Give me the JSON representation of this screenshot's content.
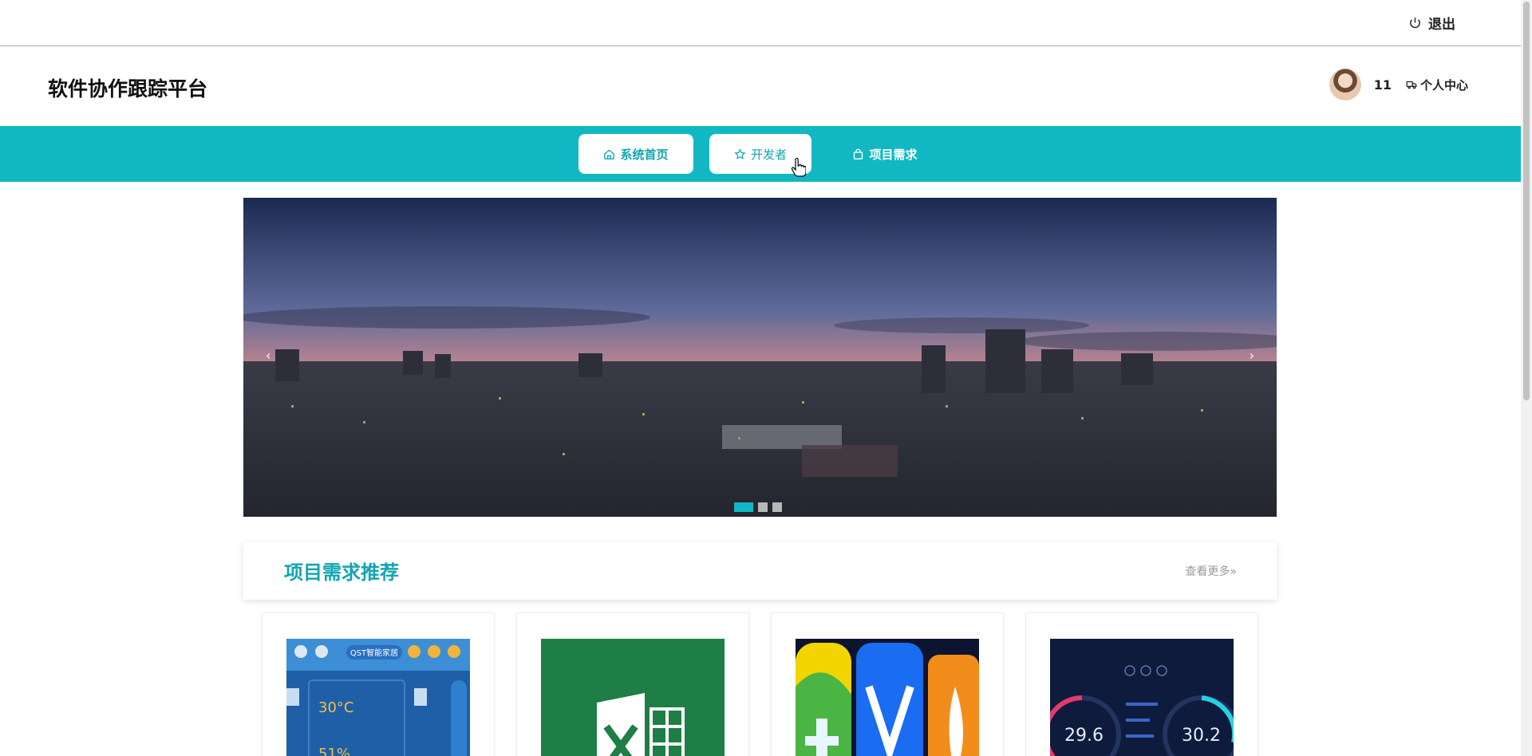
{
  "topbar": {
    "logout_label": "退出"
  },
  "header": {
    "title": "软件协作跟踪平台",
    "username": "11",
    "center_label": "个人中心"
  },
  "nav": {
    "items": [
      {
        "label": "系统首页",
        "icon": "home-icon"
      },
      {
        "label": "开发者",
        "icon": "star-icon"
      },
      {
        "label": "项目需求",
        "icon": "bag-icon"
      }
    ]
  },
  "carousel": {
    "prev_glyph": "‹",
    "next_glyph": "›",
    "slide_count": 3,
    "active_index": 0
  },
  "section": {
    "title": "项目需求推荐",
    "more_label": "查看更多»"
  },
  "cards": [
    {
      "thumbnail": "smart-home-panel"
    },
    {
      "thumbnail": "excel-logo"
    },
    {
      "thumbnail": "app-icons"
    },
    {
      "thumbnail": "dashboard-gauges"
    }
  ],
  "card_texts": {
    "panel_brand": "QST智能家居",
    "panel_temp": "30°C",
    "panel_humidity": "51%",
    "gauge_left": "29.6",
    "gauge_right": "30.2"
  },
  "colors": {
    "accent": "#11b8c3",
    "accent_text": "#11a6b0"
  }
}
